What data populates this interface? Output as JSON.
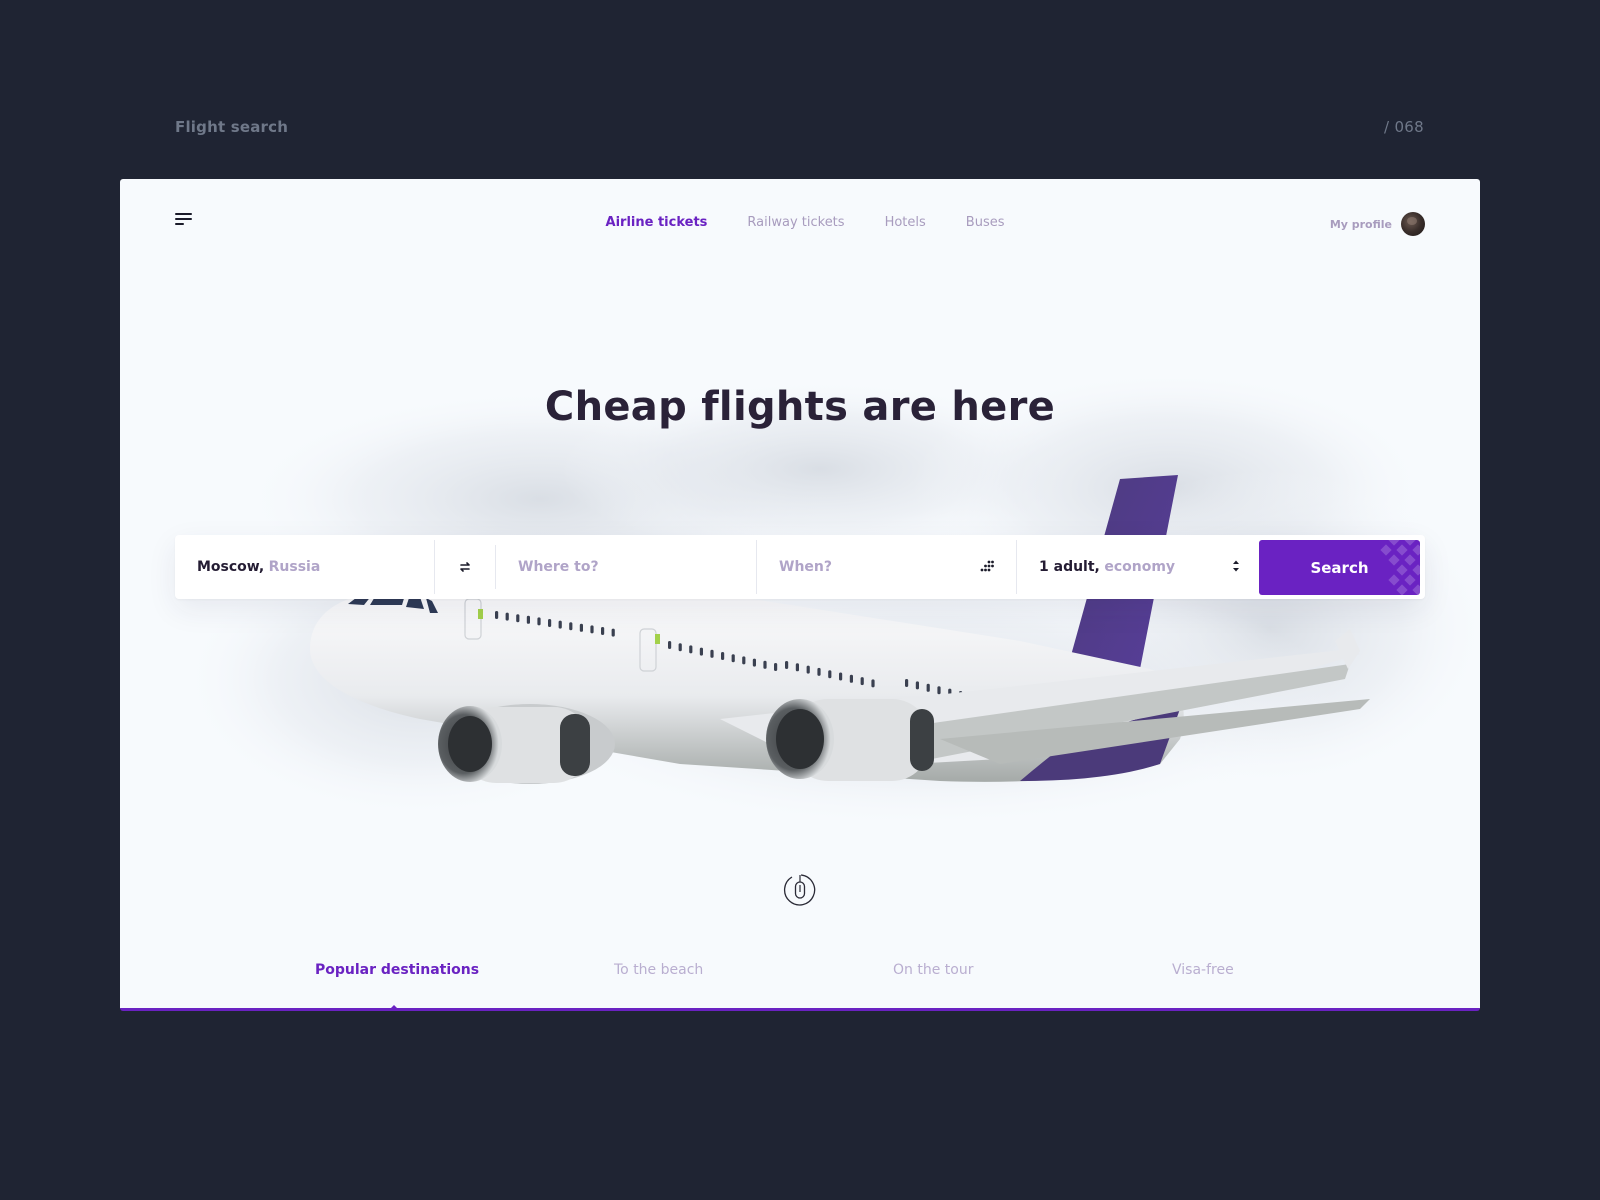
{
  "page": {
    "label": "Flight search",
    "number": "/ 068"
  },
  "header": {
    "menu_icon": "menu-icon",
    "nav": [
      {
        "label": "Airline tickets",
        "active": true
      },
      {
        "label": "Railway tickets",
        "active": false
      },
      {
        "label": "Hotels",
        "active": false
      },
      {
        "label": "Buses",
        "active": false
      }
    ],
    "profile_label": "My profile",
    "avatar_icon": "avatar"
  },
  "hero": {
    "title": "Cheap flights are here",
    "image": "airplane-in-clouds"
  },
  "search": {
    "from": {
      "city": "Moscow,",
      "country": "Russia"
    },
    "swap_icon": "swap-icon",
    "to": {
      "placeholder": "Where to?"
    },
    "when": {
      "placeholder": "When?",
      "icon": "calendar-dots-icon"
    },
    "passengers": {
      "count": "1 adult,",
      "class": "economy",
      "icon": "sort-arrows-icon"
    },
    "button_label": "Search"
  },
  "scroll_icon": "mouse-scroll-icon",
  "tabs": [
    {
      "label": "Popular destinations",
      "active": true
    },
    {
      "label": "To the beach",
      "active": false
    },
    {
      "label": "On the tour",
      "active": false
    },
    {
      "label": "Visa-free",
      "active": false
    }
  ],
  "colors": {
    "accent": "#6a22c2",
    "background": "#1f2433",
    "card": "#f7fafd",
    "heading": "#2a2238",
    "muted": "#a89cbe"
  }
}
